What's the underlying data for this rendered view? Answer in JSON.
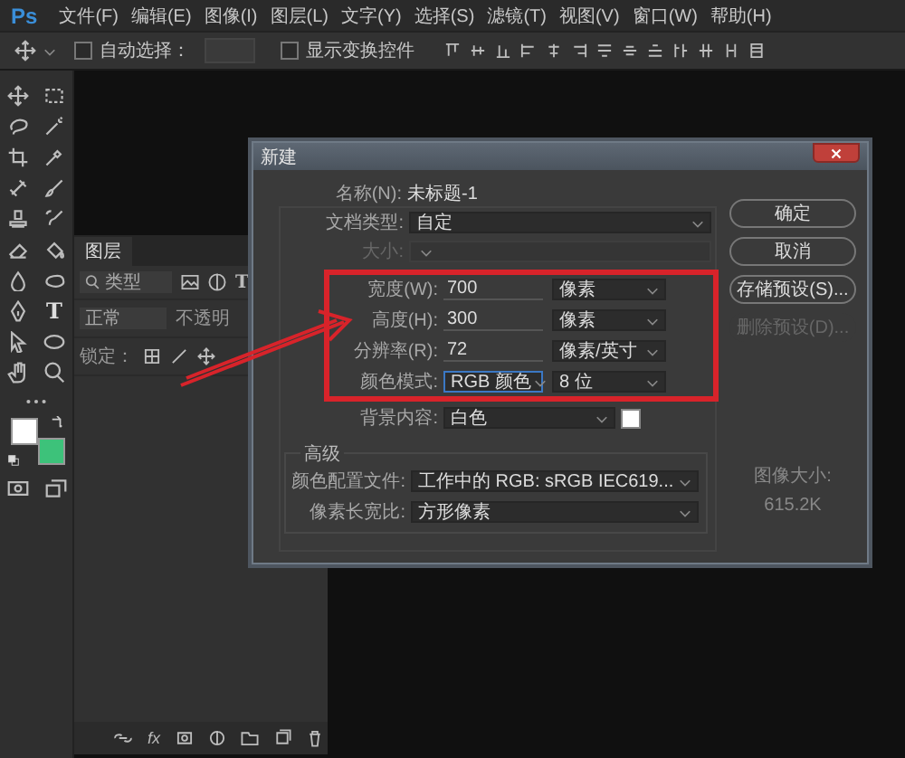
{
  "menu_bar": {
    "logo": "Ps",
    "items": [
      "文件(F)",
      "编辑(E)",
      "图像(I)",
      "图层(L)",
      "文字(Y)",
      "选择(S)",
      "滤镜(T)",
      "视图(V)",
      "窗口(W)",
      "帮助(H)"
    ]
  },
  "options_bar": {
    "checkboxes": [
      {
        "label": "自动选择：",
        "checked": false
      },
      {
        "label": "显示变换控件",
        "checked": false
      }
    ]
  },
  "tools_panel": {
    "type_tool_glyph": "T"
  },
  "layers_panel": {
    "tab": "图层",
    "filter": "类型",
    "type_filter_glyph": "T",
    "blend_mode": "正常",
    "opacity_label": "不透明",
    "lock_label": "锁定：",
    "fx_label": "fx"
  },
  "dialog": {
    "title": "新建",
    "name_label": "名称(N):",
    "name_value": "未标题-1",
    "preset_rows": [
      {
        "label": "文档类型:",
        "value": "自定",
        "disabled": false
      },
      {
        "label": "大小:",
        "disabled": true
      }
    ],
    "size_rows": [
      {
        "kind": "input",
        "label": "宽度(W):",
        "value": "700",
        "unit": "像素",
        "focused": false
      },
      {
        "kind": "input",
        "label": "高度(H):",
        "value": "300",
        "unit": "像素",
        "focused": false
      },
      {
        "kind": "input",
        "label": "分辨率(R):",
        "value": "72",
        "unit": "像素/英寸",
        "focused": false
      },
      {
        "kind": "select",
        "label": "颜色模式:",
        "value": "RGB 颜色",
        "unit": "8 位",
        "focused": true
      }
    ],
    "background": {
      "label": "背景内容:",
      "value": "白色"
    },
    "advanced": {
      "title": "高级",
      "rows": [
        {
          "label": "颜色配置文件:",
          "value": "工作中的 RGB: sRGB IEC619..."
        },
        {
          "label": "像素长宽比:",
          "value": "方形像素"
        }
      ]
    },
    "buttons": [
      {
        "label": "确定",
        "disabled": false
      },
      {
        "label": "取消",
        "disabled": false
      },
      {
        "label": "存储预设(S)...",
        "disabled": false
      },
      {
        "label": "删除预设(D)...",
        "disabled": true
      }
    ],
    "image_size": {
      "label": "图像大小:",
      "value": "615.2K"
    }
  }
}
